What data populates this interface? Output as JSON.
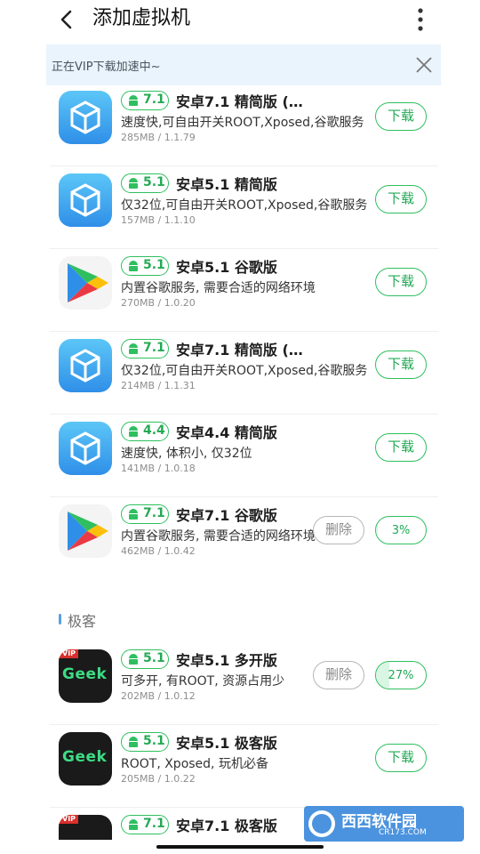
{
  "header": {
    "title": "添加虚拟机",
    "back_icon": "back-arrow-icon",
    "more_icon": "more-vertical-icon"
  },
  "banner": {
    "text": "正在VIP下载加速中~",
    "close_icon": "close-icon"
  },
  "colors": {
    "accent": "#2fbf60",
    "banner_bg": "#eaf4fd",
    "divider": "#efefef"
  },
  "items": [
    {
      "icon": "vmos-cube-icon",
      "version": "7.1",
      "name": "安卓7.1 精简版 (…",
      "desc": "速度快,可自由开关ROOT,Xposed,谷歌服务",
      "meta": "285MB / 1.1.79",
      "button": "下载"
    },
    {
      "icon": "vmos-cube-icon",
      "version": "5.1",
      "name": "安卓5.1 精简版",
      "desc": "仅32位,可自由开关ROOT,Xposed,谷歌服务",
      "meta": "157MB / 1.1.10",
      "button": "下载"
    },
    {
      "icon": "google-play-icon",
      "version": "5.1",
      "name": "安卓5.1 谷歌版",
      "desc": "内置谷歌服务, 需要合适的网络环境",
      "meta": "270MB / 1.0.20",
      "button": "下载"
    },
    {
      "icon": "vmos-cube-icon",
      "version": "7.1",
      "name": "安卓7.1 精简版 (…",
      "desc": "仅32位,可自由开关ROOT,Xposed,谷歌服务",
      "meta": "214MB / 1.1.31",
      "button": "下载"
    },
    {
      "icon": "vmos-cube-icon",
      "version": "4.4",
      "name": "安卓4.4 精简版",
      "desc": "速度快, 体积小, 仅32位",
      "meta": "141MB / 1.0.18",
      "button": "下载"
    },
    {
      "icon": "google-play-icon",
      "version": "7.1",
      "name": "安卓7.1 谷歌版",
      "desc": "内置谷歌服务, 需要合适的网络环境",
      "meta": "462MB / 1.0.42",
      "delete": "删除",
      "progress": "3%",
      "progress_value": 0.03
    }
  ],
  "section": {
    "label": "极客"
  },
  "geek_items": [
    {
      "icon": "geek-vip-icon",
      "version": "5.1",
      "name": "安卓5.1 多开版",
      "desc": "可多开, 有ROOT, 资源占用少",
      "meta": "202MB / 1.0.12",
      "delete": "删除",
      "progress": "27%",
      "progress_value": 0.27,
      "badge": "VIP",
      "logo_text": "Geek"
    },
    {
      "icon": "geek-icon",
      "version": "5.1",
      "name": "安卓5.1 极客版",
      "desc": "ROOT, Xposed, 玩机必备",
      "meta": "205MB / 1.0.22",
      "button": "下载",
      "logo_text": "Geek"
    },
    {
      "icon": "geek-vip-icon",
      "version": "7.1",
      "name": "安卓7.1 极客版",
      "badge": "VIP"
    }
  ],
  "watermark": {
    "brand": "西西软件园",
    "site": "CR173.COM"
  }
}
